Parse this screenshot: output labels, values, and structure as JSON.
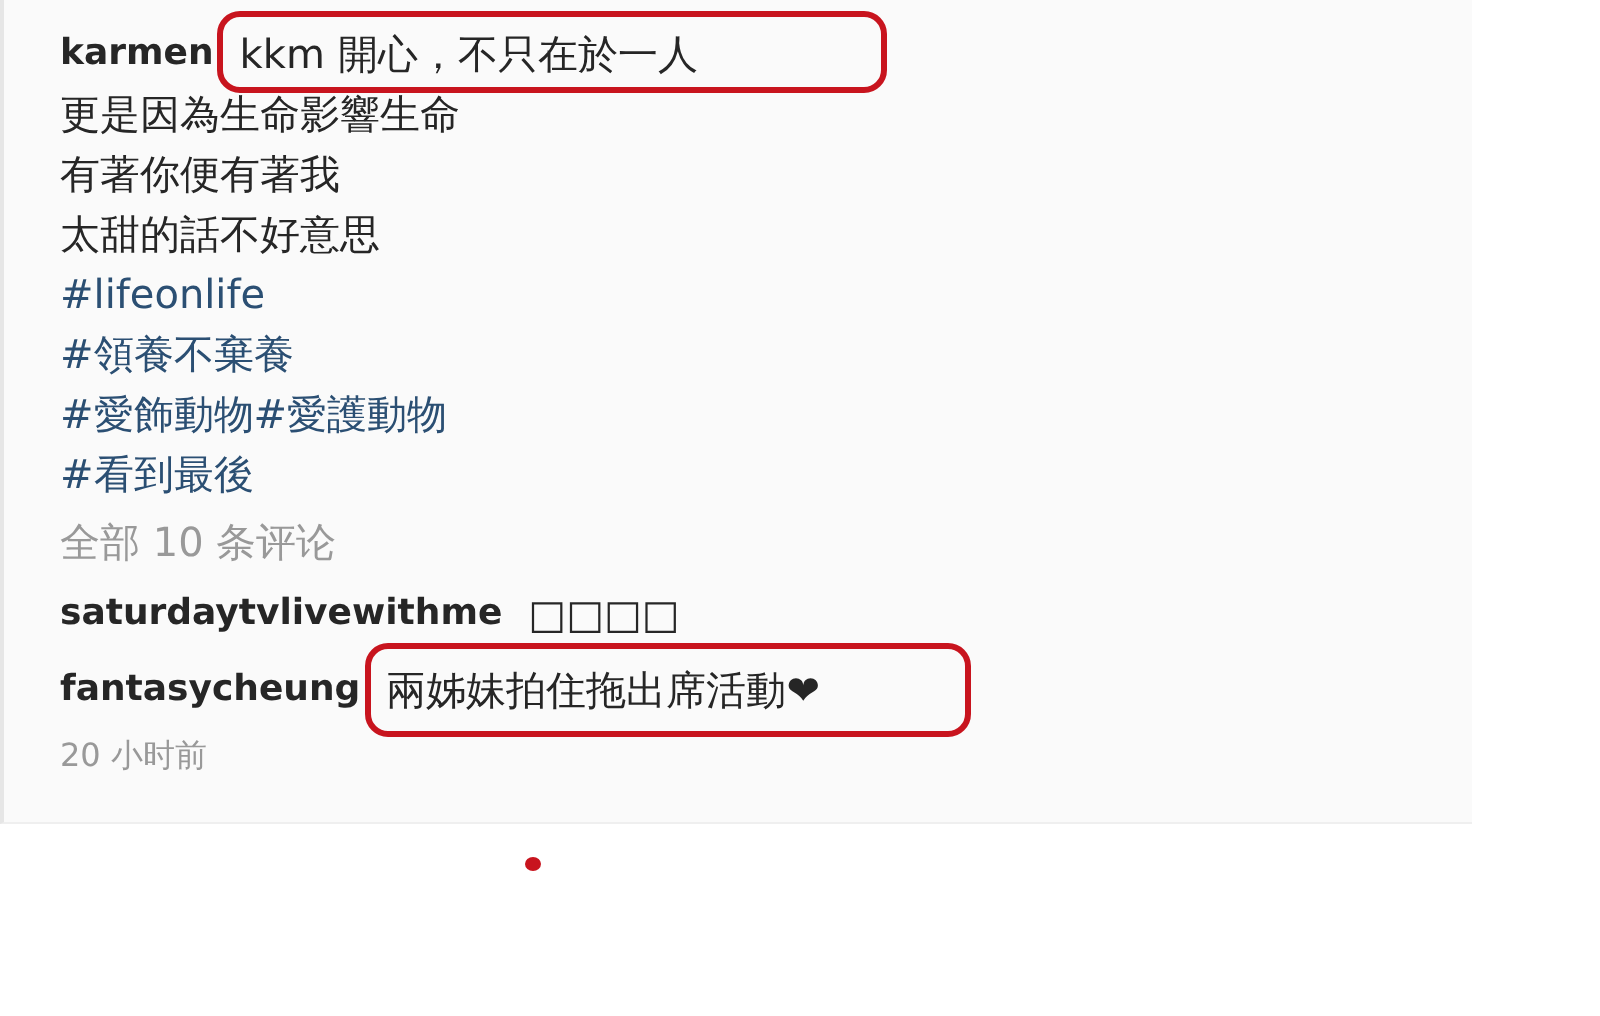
{
  "post": {
    "username": "karmen",
    "caption": [
      {
        "text": "kkm 開心，不只在於一人",
        "kind": "text"
      },
      {
        "text": "更是因為生命影響生命",
        "kind": "text"
      },
      {
        "text": "有著你便有著我",
        "kind": "text"
      },
      {
        "text": "太甜的話不好意思",
        "kind": "text"
      },
      {
        "text": "#lifeonlife",
        "kind": "hashtag"
      },
      {
        "text": "#領養不棄養",
        "kind": "hashtag"
      },
      {
        "text": "#愛飾動物#愛護動物",
        "kind": "hashtag"
      },
      {
        "text": "#看到最後",
        "kind": "hashtag"
      }
    ]
  },
  "view_all_comments": "全部 10 条评论",
  "comments": [
    {
      "username": "saturdaytvlivewithme",
      "text": "□□□□"
    },
    {
      "username": "fantasycheung",
      "text": "兩姊妹拍住拖出席活動❤"
    }
  ],
  "timestamp": "20 小时前"
}
